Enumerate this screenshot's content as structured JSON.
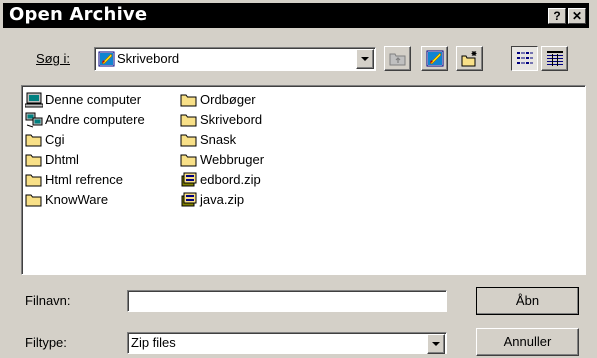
{
  "window": {
    "title": "Open Archive",
    "help_label": "?",
    "close_label": "✕"
  },
  "lookin": {
    "label": "Søg i:",
    "value": "Skrivebord",
    "icon": "desktop-icon"
  },
  "toolbar": {
    "buttons": [
      "up-one-level-icon",
      "desktop-icon",
      "new-folder-icon",
      "list-view-icon",
      "details-view-icon"
    ]
  },
  "files": {
    "column1": [
      {
        "name": "Denne computer",
        "icon": "computer-icon"
      },
      {
        "name": "Andre computere",
        "icon": "network-icon"
      },
      {
        "name": "Cgi",
        "icon": "folder-icon"
      },
      {
        "name": "Dhtml",
        "icon": "folder-icon"
      },
      {
        "name": "Html refrence",
        "icon": "folder-icon"
      },
      {
        "name": "KnowWare",
        "icon": "folder-icon"
      }
    ],
    "column2": [
      {
        "name": "Ordbøger",
        "icon": "folder-icon"
      },
      {
        "name": "Skrivebord",
        "icon": "folder-icon"
      },
      {
        "name": "Snask",
        "icon": "folder-icon"
      },
      {
        "name": "Webbruger",
        "icon": "folder-icon"
      },
      {
        "name": "edbord.zip",
        "icon": "zip-file-icon"
      },
      {
        "name": "java.zip",
        "icon": "zip-file-icon"
      }
    ]
  },
  "filename": {
    "label": "Filnavn:",
    "value": ""
  },
  "filetype": {
    "label": "Filtype:",
    "value": "Zip files"
  },
  "buttons": {
    "open": "Åbn",
    "cancel": "Annuller"
  },
  "colors": {
    "title_bar": "#000000",
    "dialog_face": "#d4d0c8",
    "folder_yellow": "#f8e088"
  }
}
